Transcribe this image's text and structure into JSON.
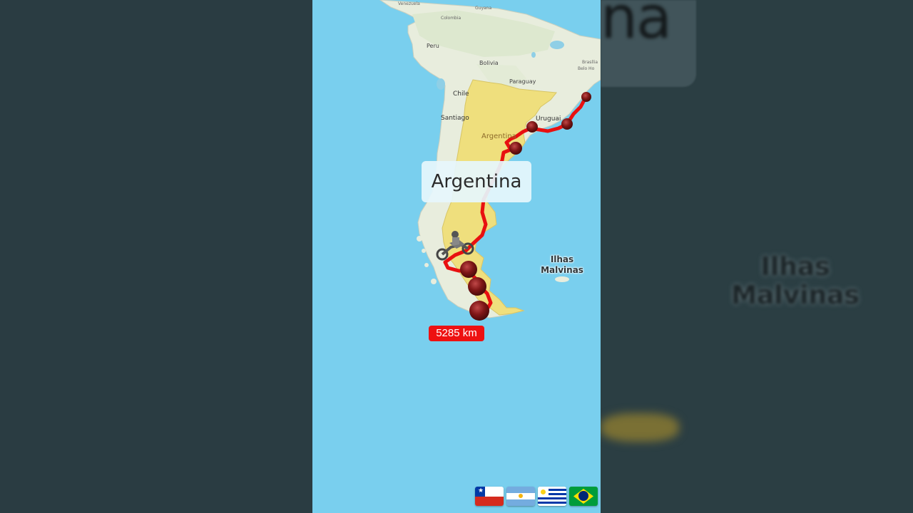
{
  "map": {
    "country_label": "Argentina",
    "islands_label_line1": "Ilhas",
    "islands_label_line2": "Malvinas",
    "distance": "5285 km",
    "labels": {
      "venezuela": "Venezuela",
      "guyana": "Guyana",
      "colombia": "Colombia",
      "peru": "Peru",
      "bolivia": "Bolivia",
      "paraguay": "Paraguay",
      "chile": "Chile",
      "santiago": "Santiago",
      "argentina_small": "Argentina",
      "uruguay": "Uruguai",
      "brasilia": "Brasília",
      "belo_horizonte": "Belo Ho"
    }
  },
  "side_panels": {
    "right_title_fragment": "na",
    "right_islands_line1": "Ilhas",
    "right_islands_line2": "Malvinas"
  },
  "flags": [
    "Chile",
    "Argentina",
    "Uruguay",
    "Brazil"
  ],
  "icons": [
    "motorcycle-rider-icon",
    "route-stop-marker-icon",
    "flag-icons"
  ],
  "colors": {
    "ocean": "#79cfee",
    "land": "#e8eddd",
    "argentina": "#efdf7d",
    "route": "#e81010",
    "marker": "#7a1a1a",
    "distance_badge": "#ee1111",
    "side_background": "#2a3c42"
  }
}
